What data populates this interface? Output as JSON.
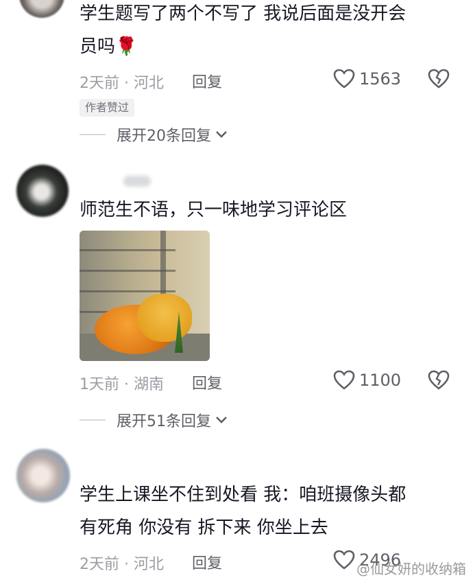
{
  "comments": [
    {
      "text_line1": "学生题写了两个不写了  我说后面是没开会",
      "text_line2": "员吗",
      "emoji": "🌹",
      "time": "2天前",
      "location": "河北",
      "reply_label": "回复",
      "likes": "1563",
      "author_badge": "作者赞过",
      "expand_label": "展开20条回复"
    },
    {
      "text_line1": "师范生不语，只一味地学习评论区",
      "time": "1天前",
      "location": "湖南",
      "reply_label": "回复",
      "likes": "1100",
      "expand_label": "展开51条回复"
    },
    {
      "text_line1": "学生上课坐不住到处看 我：咱班摄像头都",
      "text_line2": "有死角 你没有 拆下来 你坐上去",
      "time": "2天前",
      "location": "河北",
      "reply_label": "回复",
      "likes": "2496"
    }
  ],
  "separator": "·",
  "watermark": "@仙女妍的收纳箱",
  "icons": [
    "heart-icon",
    "dislike-icon",
    "chevron-down-icon"
  ],
  "colors": {
    "text": "#161823",
    "meta": "#9a9ca3",
    "secondary": "#5d5f66"
  }
}
